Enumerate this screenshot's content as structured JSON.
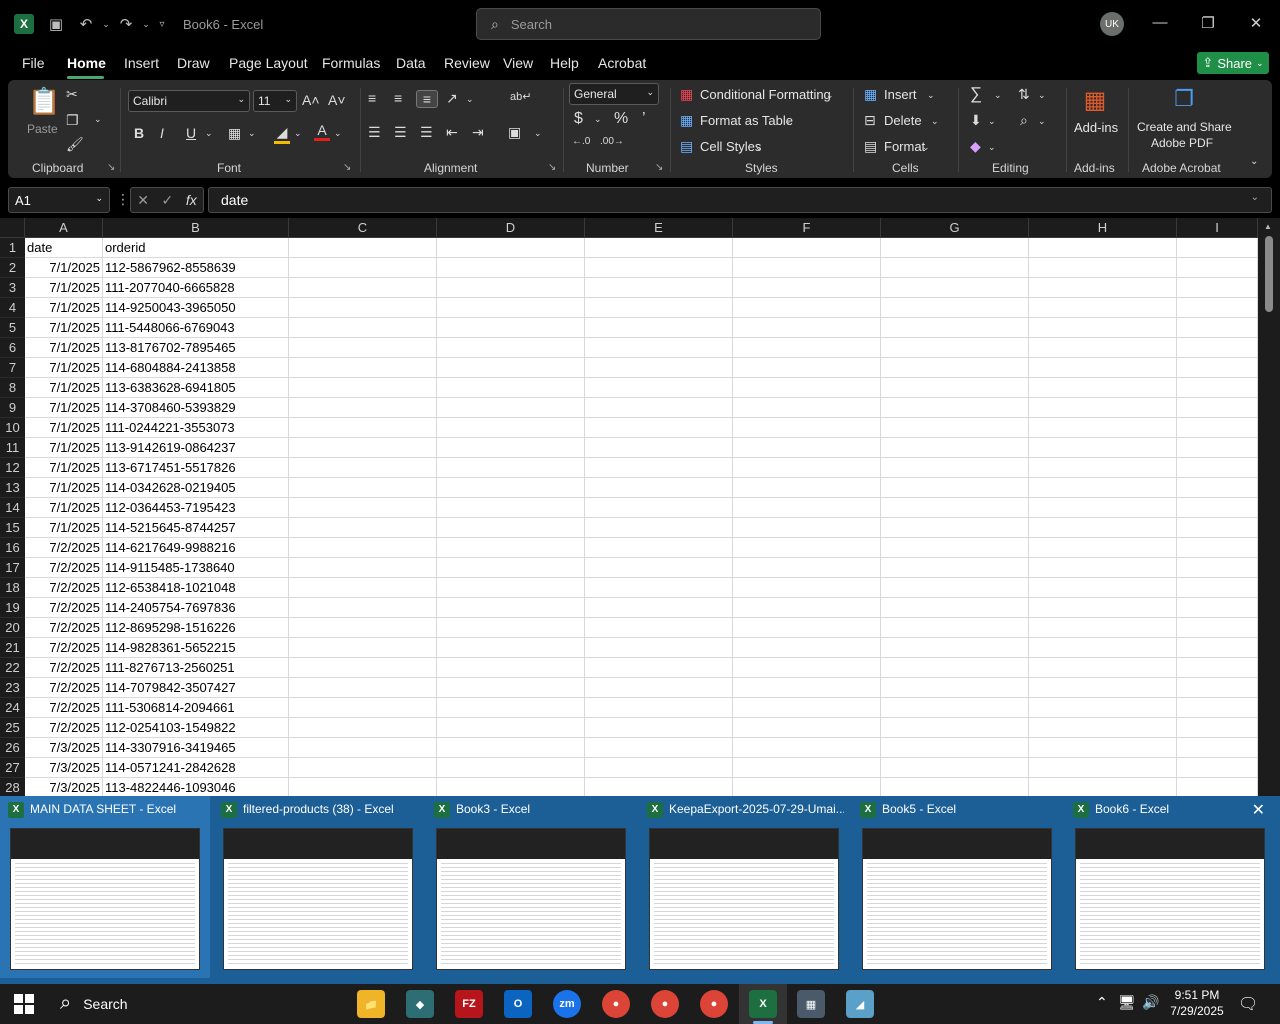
{
  "window": {
    "title": "Book6 - Excel",
    "search_placeholder": "Search",
    "avatar_initials": "UK"
  },
  "menu": {
    "tabs": [
      "File",
      "Home",
      "Insert",
      "Draw",
      "Page Layout",
      "Formulas",
      "Data",
      "Review",
      "View",
      "Help",
      "Acrobat"
    ],
    "active": "Home",
    "share_label": "Share"
  },
  "ribbon": {
    "clipboard": {
      "label": "Clipboard",
      "paste": "Paste"
    },
    "font": {
      "label": "Font",
      "family": "Calibri",
      "size": "11"
    },
    "alignment": {
      "label": "Alignment"
    },
    "number": {
      "label": "Number",
      "format": "General"
    },
    "styles": {
      "label": "Styles",
      "conditional": "Conditional Formatting",
      "format_table": "Format as Table",
      "cell_styles": "Cell Styles"
    },
    "cells": {
      "label": "Cells",
      "insert": "Insert",
      "delete": "Delete",
      "format": "Format"
    },
    "editing": {
      "label": "Editing"
    },
    "addins": {
      "label": "Add-ins",
      "button": "Add-ins"
    },
    "acrobat": {
      "label": "Adobe Acrobat",
      "line1": "Create and Share",
      "line2": "Adobe PDF"
    }
  },
  "formula_bar": {
    "name_box": "A1",
    "value": "date"
  },
  "columns": [
    "A",
    "B",
    "C",
    "D",
    "E",
    "F",
    "G",
    "H",
    "I"
  ],
  "rows": [
    {
      "n": "1",
      "a": "date",
      "b": "orderid"
    },
    {
      "n": "2",
      "a": "7/1/2025",
      "b": "112-5867962-8558639"
    },
    {
      "n": "3",
      "a": "7/1/2025",
      "b": "111-2077040-6665828"
    },
    {
      "n": "4",
      "a": "7/1/2025",
      "b": "114-9250043-3965050"
    },
    {
      "n": "5",
      "a": "7/1/2025",
      "b": "111-5448066-6769043"
    },
    {
      "n": "6",
      "a": "7/1/2025",
      "b": "113-8176702-7895465"
    },
    {
      "n": "7",
      "a": "7/1/2025",
      "b": "114-6804884-2413858"
    },
    {
      "n": "8",
      "a": "7/1/2025",
      "b": "113-6383628-6941805"
    },
    {
      "n": "9",
      "a": "7/1/2025",
      "b": "114-3708460-5393829"
    },
    {
      "n": "10",
      "a": "7/1/2025",
      "b": "111-0244221-3553073"
    },
    {
      "n": "11",
      "a": "7/1/2025",
      "b": "113-9142619-0864237"
    },
    {
      "n": "12",
      "a": "7/1/2025",
      "b": "113-6717451-5517826"
    },
    {
      "n": "13",
      "a": "7/1/2025",
      "b": "114-0342628-0219405"
    },
    {
      "n": "14",
      "a": "7/1/2025",
      "b": "112-0364453-7195423"
    },
    {
      "n": "15",
      "a": "7/1/2025",
      "b": "114-5215645-8744257"
    },
    {
      "n": "16",
      "a": "7/2/2025",
      "b": "114-6217649-9988216"
    },
    {
      "n": "17",
      "a": "7/2/2025",
      "b": "114-9115485-1738640"
    },
    {
      "n": "18",
      "a": "7/2/2025",
      "b": "112-6538418-1021048"
    },
    {
      "n": "19",
      "a": "7/2/2025",
      "b": "114-2405754-7697836"
    },
    {
      "n": "20",
      "a": "7/2/2025",
      "b": "112-8695298-1516226"
    },
    {
      "n": "21",
      "a": "7/2/2025",
      "b": "114-9828361-5652215"
    },
    {
      "n": "22",
      "a": "7/2/2025",
      "b": "111-8276713-2560251"
    },
    {
      "n": "23",
      "a": "7/2/2025",
      "b": "114-7079842-3507427"
    },
    {
      "n": "24",
      "a": "7/2/2025",
      "b": "111-5306814-2094661"
    },
    {
      "n": "25",
      "a": "7/2/2025",
      "b": "112-0254103-1549822"
    },
    {
      "n": "26",
      "a": "7/3/2025",
      "b": "114-3307916-3419465"
    },
    {
      "n": "27",
      "a": "7/3/2025",
      "b": "114-0571241-2842628"
    },
    {
      "n": "28",
      "a": "7/3/2025",
      "b": "113-4822446-1093046"
    }
  ],
  "thumbnails": [
    {
      "title": "MAIN DATA SHEET - Excel"
    },
    {
      "title": "filtered-products (38) - Excel"
    },
    {
      "title": "Book3 - Excel"
    },
    {
      "title": "KeepaExport-2025-07-29-Umai..."
    },
    {
      "title": "Book5 - Excel"
    },
    {
      "title": "Book6 - Excel"
    }
  ],
  "taskbar": {
    "search_label": "Search",
    "time": "9:51 PM",
    "date": "7/29/2025"
  }
}
